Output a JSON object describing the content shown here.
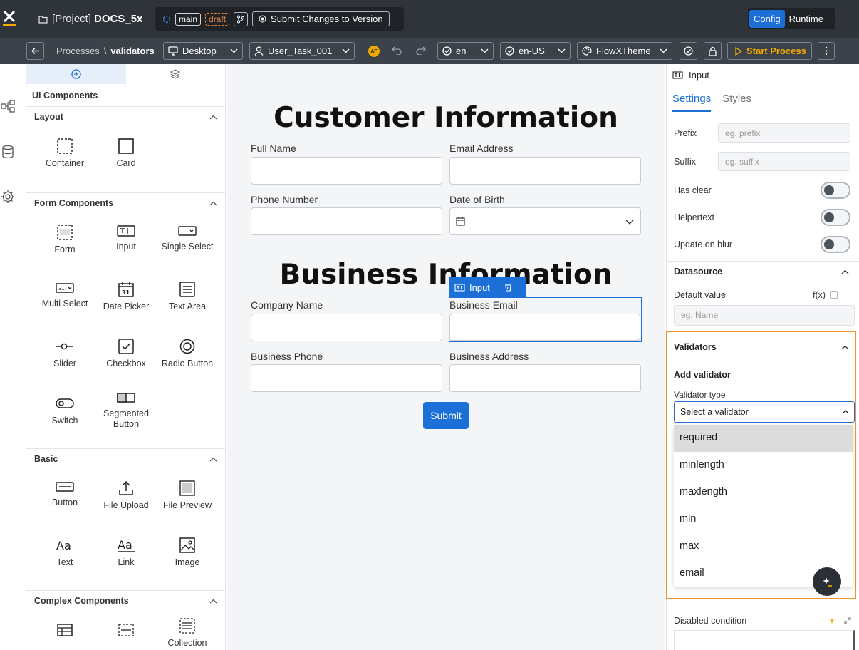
{
  "topbar": {
    "logo": "X",
    "project_prefix": "[Project]",
    "project_name": "DOCS_5x",
    "branch": "main",
    "status": "draft",
    "submit_changes": "Submit Changes to Version",
    "mode_config": "Config",
    "mode_runtime": "Runtime"
  },
  "toolbar": {
    "breadcrumb_parent": "Processes",
    "breadcrumb_sep": "\\",
    "breadcrumb_current": "validators",
    "device": "Desktop",
    "user_task": "User_Task_001",
    "avatar_initials": "AF",
    "language": "en",
    "locale": "en-US",
    "theme": "FlowXTheme",
    "start_process": "Start Process"
  },
  "components_panel": {
    "title": "UI Components",
    "sections": [
      {
        "name": "Layout",
        "items": [
          "Container",
          "Card"
        ]
      },
      {
        "name": "Form Components",
        "items": [
          "Form",
          "Input",
          "Single Select",
          "Multi Select",
          "Date Picker",
          "Text Area",
          "Slider",
          "Checkbox",
          "Radio Button",
          "Switch",
          "Segmented Button"
        ]
      },
      {
        "name": "Basic",
        "items": [
          "Button",
          "File Upload",
          "File Preview",
          "Text",
          "Link",
          "Image"
        ]
      },
      {
        "name": "Complex Components",
        "items": [
          "",
          "",
          "Collection"
        ]
      }
    ]
  },
  "canvas": {
    "title1": "Customer Information",
    "full_name": "Full Name",
    "email_address": "Email Address",
    "phone_number": "Phone Number",
    "date_of_birth": "Date of Birth",
    "title2": "Business Information",
    "company_name": "Company Name",
    "business_email": "Business Email",
    "business_phone": "Business Phone",
    "business_address": "Business Address",
    "submit": "Submit",
    "selected_tag": "Input"
  },
  "right_panel": {
    "component": "Input",
    "tab_settings": "Settings",
    "tab_styles": "Styles",
    "prefix_label": "Prefix",
    "prefix_placeholder": "eg. prefix",
    "suffix_label": "Suffix",
    "suffix_placeholder": "eg. suffix",
    "has_clear": "Has clear",
    "helpertext": "Helpertext",
    "update_on_blur": "Update on blur",
    "datasource": "Datasource",
    "default_value": "Default value",
    "fx": "f(x)",
    "default_placeholder": "eg. Name",
    "validators": "Validators",
    "add_validator": "Add validator",
    "validator_type": "Validator type",
    "validator_select": "Select a validator",
    "validator_options": [
      "required",
      "minlength",
      "maxlength",
      "min",
      "max",
      "email"
    ],
    "disabled_condition": "Disabled condition"
  },
  "colors": {
    "accent": "#1c6fd6",
    "highlight_border": "#f0922e",
    "topbar": "#2f343b"
  }
}
